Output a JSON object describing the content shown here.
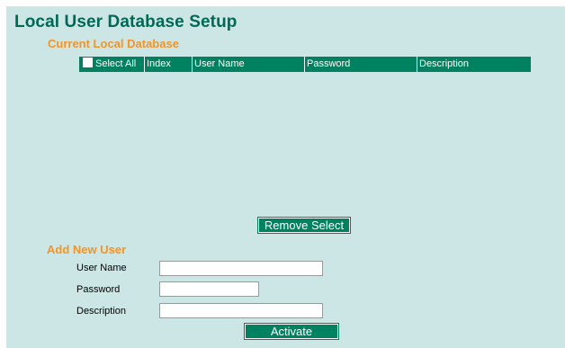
{
  "page": {
    "title": "Local User Database Setup"
  },
  "current_db": {
    "heading": "Current Local Database",
    "columns": {
      "select_all": "Select All",
      "index": "Index",
      "user_name": "User Name",
      "password": "Password",
      "description": "Description"
    },
    "rows": [],
    "remove_button": "Remove Select"
  },
  "add_user": {
    "heading": "Add New User",
    "user_name_label": "User Name",
    "user_name_value": "",
    "password_label": "Password",
    "password_value": "",
    "description_label": "Description",
    "description_value": "",
    "activate_button": "Activate"
  },
  "colors": {
    "panel_bg": "#cce6e6",
    "title": "#006955",
    "section_heading": "#f7931e",
    "header_bg": "#00815f"
  }
}
